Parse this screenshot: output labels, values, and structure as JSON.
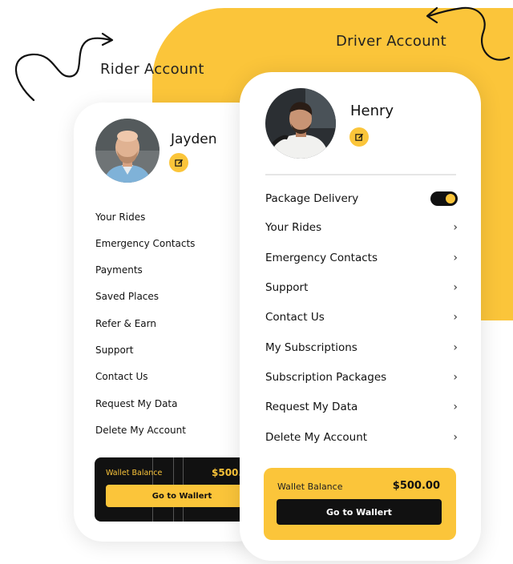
{
  "colors": {
    "accent": "#fbc53a",
    "dark": "#111111"
  },
  "labels": {
    "rider_account": "Rider Account",
    "driver_account": "Driver Account"
  },
  "rider": {
    "name": "Jayden",
    "menu": [
      "Your Rides",
      "Emergency Contacts",
      "Payments",
      "Saved Places",
      "Refer & Earn",
      "Support",
      "Contact Us",
      "Request My Data",
      "Delete My Account"
    ],
    "wallet": {
      "label": "Wallet Balance",
      "amount": "$500.",
      "button": "Go to Wallert"
    }
  },
  "driver": {
    "name": "Henry",
    "toggle_item": {
      "label": "Package Delivery",
      "on": true
    },
    "menu": [
      "Your Rides",
      "Emergency Contacts",
      "Support",
      "Contact Us",
      "My Subscriptions",
      "Subscription Packages",
      "Request My Data",
      "Delete My Account"
    ],
    "chevron": "›",
    "wallet": {
      "label": "Wallet Balance",
      "amount": "$500.00",
      "button": "Go to Wallert"
    }
  }
}
